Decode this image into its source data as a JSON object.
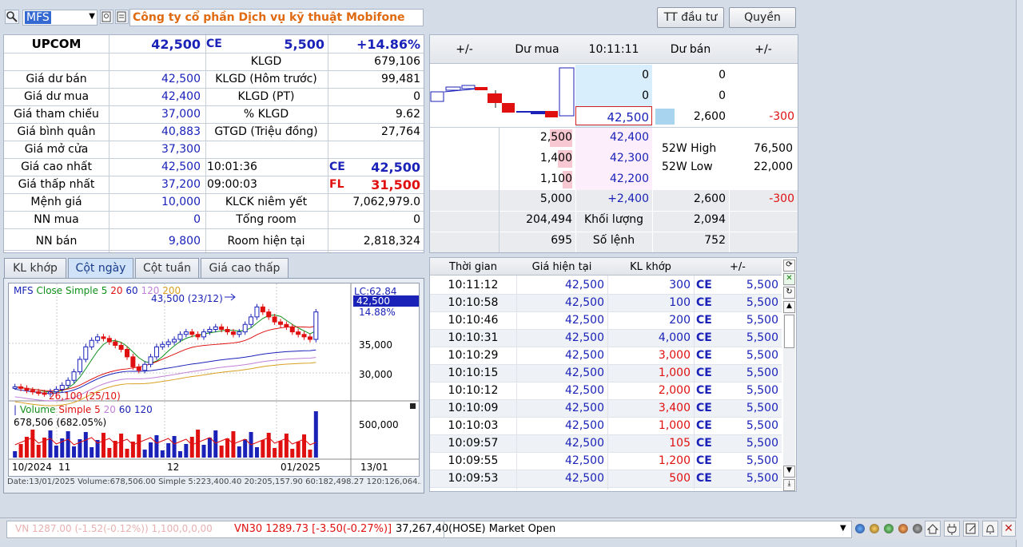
{
  "toolbar": {
    "symbol": "MFS",
    "company_name": "Công ty cổ phần Dịch vụ kỹ thuật Mobifone",
    "investor_info_btn": "TT đầu tư",
    "rights_btn": "Quyền"
  },
  "summary": {
    "exchange": "UPCOM",
    "price": "42,500",
    "ce_label": "CE",
    "change": "5,500",
    "change_pct": "+14.86%",
    "rows_left": [
      {
        "label": "",
        "value": ""
      },
      {
        "label": "Giá dư bán",
        "value": "42,500"
      },
      {
        "label": "Giá dư mua",
        "value": "42,400"
      },
      {
        "label": "Giá tham chiếu",
        "value": "37,000"
      },
      {
        "label": "Giá bình quân",
        "value": "40,883"
      },
      {
        "label": "Giá mở cửa",
        "value": "37,300"
      },
      {
        "label": "Giá cao nhất",
        "value": "42,500"
      },
      {
        "label": "Giá thấp nhất",
        "value": "37,200"
      },
      {
        "label": "Mệnh giá",
        "value": "10,000"
      },
      {
        "label": "NN mua",
        "value": "0"
      },
      {
        "label": "NN bán",
        "value": "9,800"
      }
    ],
    "rows_right": [
      {
        "label": "KLGD",
        "value": "679,106"
      },
      {
        "label": "KLGD (Hôm trước)",
        "value": "99,481"
      },
      {
        "label": "KLGD (PT)",
        "value": "0"
      },
      {
        "label": "% KLGD",
        "value": "9.62"
      },
      {
        "label": "GTGD (Triệu đồng)",
        "value": "27,764"
      },
      {
        "label": "",
        "value": ""
      },
      {
        "label": "10:01:36",
        "value": ""
      },
      {
        "label": "09:00:03",
        "value": ""
      },
      {
        "label": "KLCK niêm yết",
        "value": "7,062,979.0"
      },
      {
        "label": "Tổng room",
        "value": "0"
      },
      {
        "label": "Room hiện tại",
        "value": "2,818,324"
      }
    ],
    "ce_tag": "CE",
    "ce_value": "42,500",
    "fl_tag": "FL",
    "fl_value": "31,500"
  },
  "orderbook": {
    "headers": [
      "+/-",
      "Dư mua",
      "10:11:11",
      "Dư bán",
      "+/-"
    ],
    "ask_rows": [
      {
        "price": "0",
        "vol": "0",
        "chg": ""
      },
      {
        "price": "0",
        "vol": "0",
        "chg": ""
      },
      {
        "price": "42,500",
        "vol": "2,600",
        "chg": "-300"
      }
    ],
    "bid_rows": [
      {
        "vol": "2,500",
        "price": "42,400"
      },
      {
        "vol": "1,400",
        "price": "42,300"
      },
      {
        "vol": "1,100",
        "price": "42,200"
      }
    ],
    "w52_high_label": "52W High",
    "w52_high": "76,500",
    "w52_low_label": "52W Low",
    "w52_low": "22,000",
    "total_row": {
      "bid": "5,000",
      "diff": "+2,400",
      "ask": "2,600",
      "chg": "-300"
    },
    "volume_row": {
      "left": "204,494",
      "label": "Khối lượng",
      "right": "2,094"
    },
    "orders_row": {
      "left": "695",
      "label": "Số lệnh",
      "right": "752"
    }
  },
  "tabs": [
    "KL khớp",
    "Cột ngày",
    "Cột tuần",
    "Giá cao thấp"
  ],
  "chart": {
    "legend_symbol": "MFS",
    "legend_ma_label": "Close Simple 5",
    "legend_ma_periods": [
      "20",
      "60",
      "120",
      "200"
    ],
    "annotation_high": "43,500 (23/12)",
    "annotation_low": "26,100 (25/10)",
    "lc_label": "LC:62.84",
    "last_price": "42,500",
    "last_pct": "14.88%",
    "y_ticks": [
      "35,000",
      "30,000"
    ],
    "vol_legend_label": "Volume",
    "vol_legend_ma": "Simple 5",
    "vol_legend_periods": [
      "20",
      "60",
      "120"
    ],
    "vol_value": "678,506 (682.05%)",
    "vol_tick": "500,000",
    "x_labels": [
      "10/2024",
      "11",
      "12",
      "01/2025"
    ],
    "x_right": "13/01",
    "status": "Date:13/01/2025  Volume:678,506.00  Simple 5:223,400.40  20:205,157.90  60:182,498.27  120:126,064..."
  },
  "chart_data": {
    "type": "candlestick",
    "title": "MFS",
    "series": [
      {
        "name": "MFS",
        "values": [
          27.5,
          27.2,
          26.8,
          26.5,
          26.3,
          26.1,
          26.5,
          27.0,
          27.8,
          28.8,
          30.5,
          33.0,
          35.5,
          36.8,
          37.5,
          37.2,
          36.5,
          35.8,
          35.0,
          33.5,
          31.5,
          30.8,
          32.0,
          33.5,
          35.5,
          36.0,
          36.5,
          37.0,
          38.0,
          38.5,
          38.0,
          37.5,
          38.5,
          39.0,
          39.5,
          39.0,
          38.5,
          38.0,
          38.5,
          40.0,
          41.5,
          43.5,
          42.5,
          41.5,
          40.5,
          40.0,
          39.5,
          38.5,
          38.0,
          37.5,
          37.0,
          42.5
        ]
      }
    ],
    "ylim": [
      25,
      45
    ]
  },
  "ticks": {
    "headers": [
      "Thời gian",
      "Giá hiện tại",
      "KL khớp",
      "+/-"
    ],
    "rows": [
      {
        "time": "10:11:12",
        "price": "42,500",
        "vol": "300",
        "tag": "CE",
        "chg": "5,500",
        "vcolor": "blue"
      },
      {
        "time": "10:10:58",
        "price": "42,500",
        "vol": "100",
        "tag": "CE",
        "chg": "5,500",
        "vcolor": "blue"
      },
      {
        "time": "10:10:46",
        "price": "42,500",
        "vol": "200",
        "tag": "CE",
        "chg": "5,500",
        "vcolor": "blue"
      },
      {
        "time": "10:10:31",
        "price": "42,500",
        "vol": "4,000",
        "tag": "CE",
        "chg": "5,500",
        "vcolor": "blue"
      },
      {
        "time": "10:10:29",
        "price": "42,500",
        "vol": "3,000",
        "tag": "CE",
        "chg": "5,500",
        "vcolor": "red"
      },
      {
        "time": "10:10:15",
        "price": "42,500",
        "vol": "1,000",
        "tag": "CE",
        "chg": "5,500",
        "vcolor": "red"
      },
      {
        "time": "10:10:12",
        "price": "42,500",
        "vol": "2,000",
        "tag": "CE",
        "chg": "5,500",
        "vcolor": "red"
      },
      {
        "time": "10:10:09",
        "price": "42,500",
        "vol": "3,400",
        "tag": "CE",
        "chg": "5,500",
        "vcolor": "red"
      },
      {
        "time": "10:10:03",
        "price": "42,500",
        "vol": "1,000",
        "tag": "CE",
        "chg": "5,500",
        "vcolor": "red"
      },
      {
        "time": "10:09:57",
        "price": "42,500",
        "vol": "105",
        "tag": "CE",
        "chg": "5,500",
        "vcolor": "red"
      },
      {
        "time": "10:09:55",
        "price": "42,500",
        "vol": "1,200",
        "tag": "CE",
        "chg": "5,500",
        "vcolor": "red"
      },
      {
        "time": "10:09:53",
        "price": "42,500",
        "vol": "500",
        "tag": "CE",
        "chg": "5,500",
        "vcolor": "red"
      }
    ]
  },
  "statusbar": {
    "ticker_faded": "VN 1287.00 (-1.52(-0.12%)) 1,100,0,0,00",
    "vn30": "VN30 1289.73 [-3.50(-0.27%)]",
    "vn30_vol": "37,267,40",
    "market_status": "(HOSE) Market Open"
  },
  "colors": {
    "up": "#e01010",
    "down": "#1a22b8",
    "accent": "#e06a10",
    "ce": "#1a22b8",
    "fl": "#e01010"
  }
}
